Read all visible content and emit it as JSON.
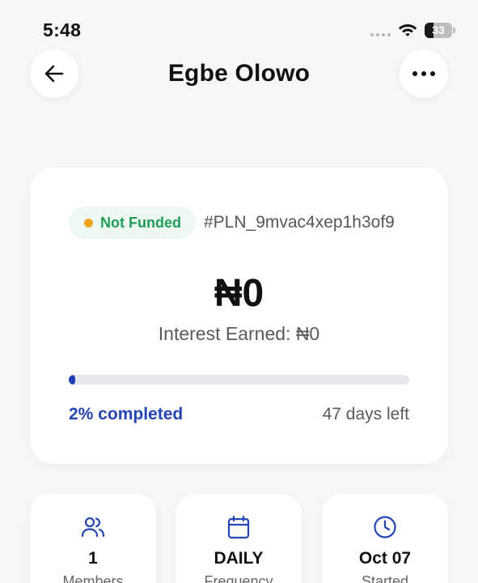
{
  "status_bar": {
    "time": "5:48",
    "battery_level": "33",
    "battery_fraction": 0.33
  },
  "header": {
    "title": "Egbe Olowo",
    "back_icon": "arrow-left-icon",
    "more_icon": "more-horizontal-icon"
  },
  "plan": {
    "status_badge": "Not Funded",
    "status_dot_color": "#f3a41d",
    "plan_id": "#PLN_9mvac4xep1h3of9",
    "balance": "₦0",
    "interest_label": "Interest Earned:",
    "interest_value": "₦0",
    "progress_percent": 2,
    "completed_text": "2% completed",
    "days_left_text": "47 days left"
  },
  "stats": [
    {
      "icon": "users-icon",
      "value": "1",
      "label": "Members"
    },
    {
      "icon": "calendar-icon",
      "value": "DAILY",
      "label": "Frequency"
    },
    {
      "icon": "clock-icon",
      "value": "Oct 07",
      "label": "Started"
    }
  ],
  "colors": {
    "accent": "#2545b5",
    "success_text": "#1f9d57",
    "badge_bg": "#ecf8f1",
    "background": "#f6f7f9"
  }
}
